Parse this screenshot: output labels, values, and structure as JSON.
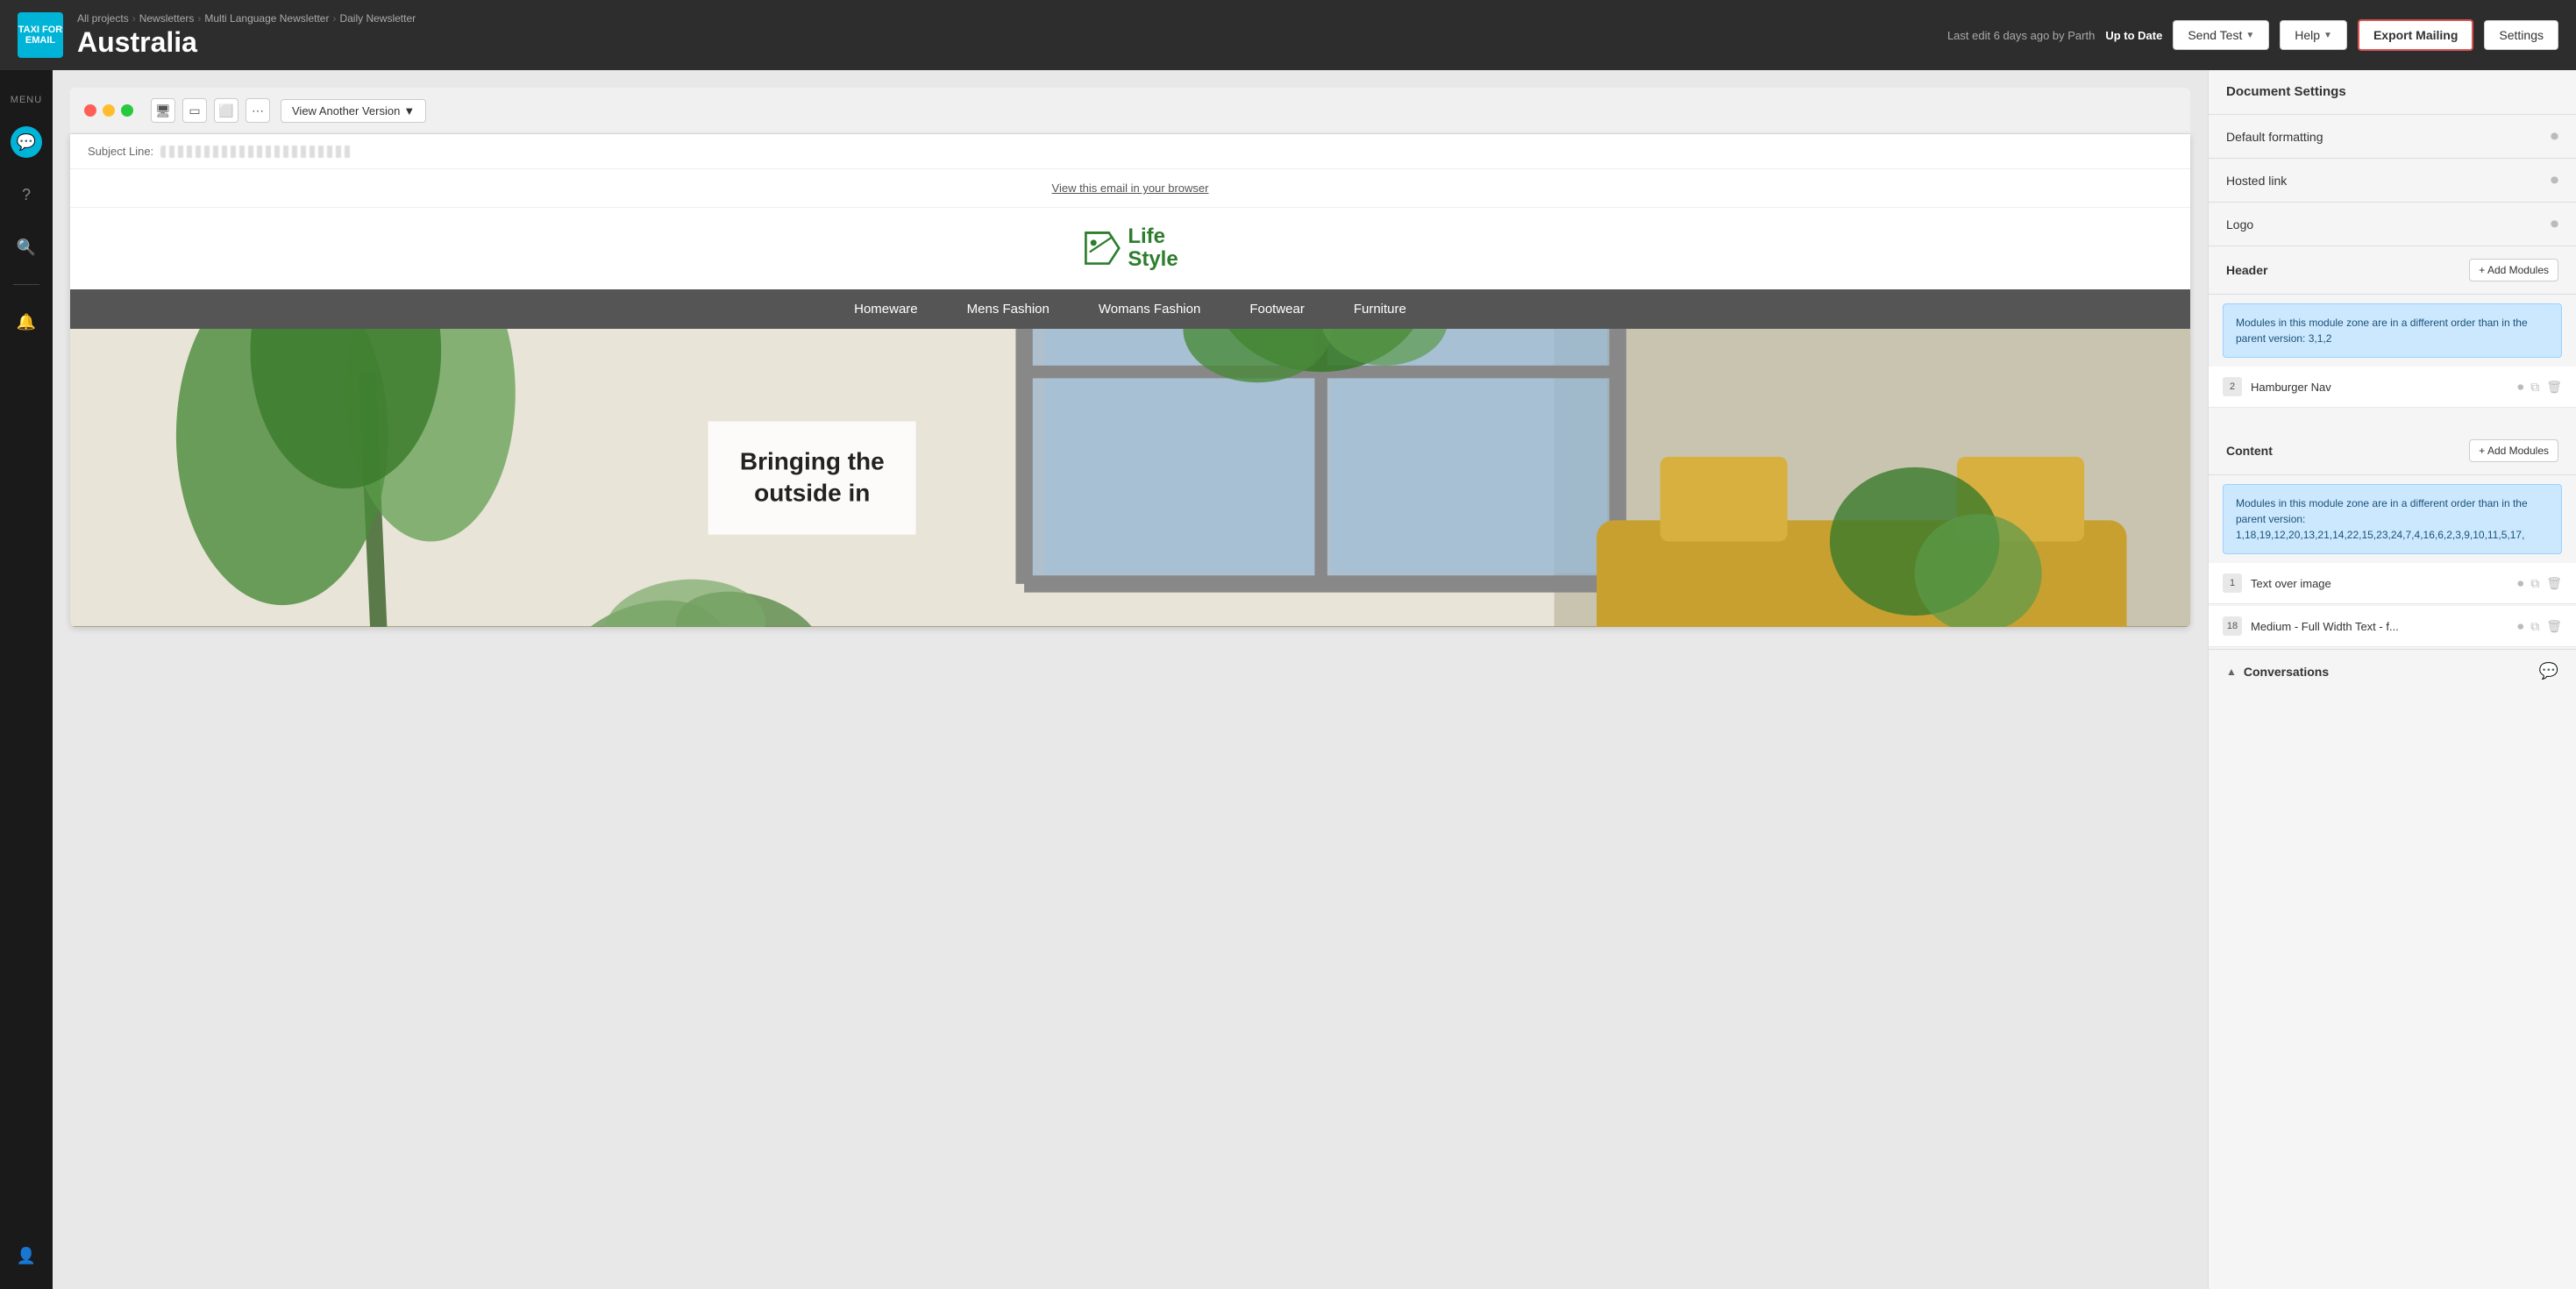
{
  "app": {
    "logo_text": "TAXI\nFOR EMAIL"
  },
  "breadcrumb": {
    "items": [
      "All projects",
      "Newsletters",
      "Multi Language Newsletter",
      "Daily Newsletter"
    ],
    "separators": [
      "›",
      "›",
      "›"
    ]
  },
  "header": {
    "page_title": "Australia",
    "last_edit": "Last edit 6 days ago by Parth",
    "status_badge": "Up to Date"
  },
  "toolbar_buttons": {
    "send_test": "Send Test",
    "help": "Help",
    "export_mailing": "Export Mailing",
    "settings": "Settings"
  },
  "menu": {
    "label": "MENU"
  },
  "preview": {
    "view_another_version": "View Another Version",
    "subject_label": "Subject Line:",
    "view_browser_link": "View this email in your browser"
  },
  "email_content": {
    "logo_text_line1": "Life",
    "logo_text_line2": "Style",
    "nav_items": [
      "Homeware",
      "Mens Fashion",
      "Womans Fashion",
      "Footwear",
      "Furniture"
    ],
    "hero_text_line1": "Bringing the",
    "hero_text_line2": "outside in"
  },
  "right_panel": {
    "document_settings": {
      "title": "Document Settings"
    },
    "rows": [
      {
        "label": "Default formatting"
      },
      {
        "label": "Hosted link"
      },
      {
        "label": "Logo"
      }
    ],
    "header_zone": {
      "title": "Header",
      "add_btn": "+ Add Modules",
      "alert": "Modules in this module zone are in a different order than in the parent version: 3,1,2",
      "modules": [
        {
          "number": "2",
          "name": "Hamburger Nav"
        }
      ]
    },
    "content_zone": {
      "title": "Content",
      "add_btn": "+ Add Modules",
      "alert": "Modules in this module zone are in a different order than in the parent version: 1,18,19,12,20,13,21,14,22,15,23,24,7,4,16,6,2,3,9,10,11,5,17,",
      "modules": [
        {
          "number": "1",
          "name": "Text over image"
        },
        {
          "number": "18",
          "name": "Medium - Full Width Text - f..."
        }
      ]
    },
    "conversations": {
      "label": "Conversations"
    }
  }
}
